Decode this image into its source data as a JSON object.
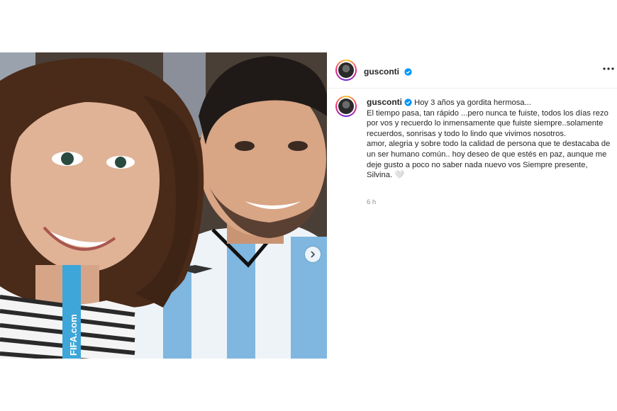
{
  "post": {
    "username": "gusconti",
    "more_icon": "more-horizontal-icon",
    "caption": {
      "line1": "Hoy 3 años ya gordita hermosa...",
      "para1": "El tiempo pasa, tan rápido ...pero nunca te fuiste, todos los días rezo por vos y recuerdo lo inmensamente que fuiste siempre..solamente recuerdos, sonrisas y todo lo lindo que vivimos nosotros.",
      "para2": "amor, alegria y sobre todo la calidad de persona que te destacaba de un ser humano común.. hoy deseo de que estés en paz, aunque me deje gusto a poco no saber nada nuevo vos Siempre presente, Silvina. 🤍"
    },
    "timestamp": "6 h",
    "lanyard_text": "FIFA.com"
  }
}
